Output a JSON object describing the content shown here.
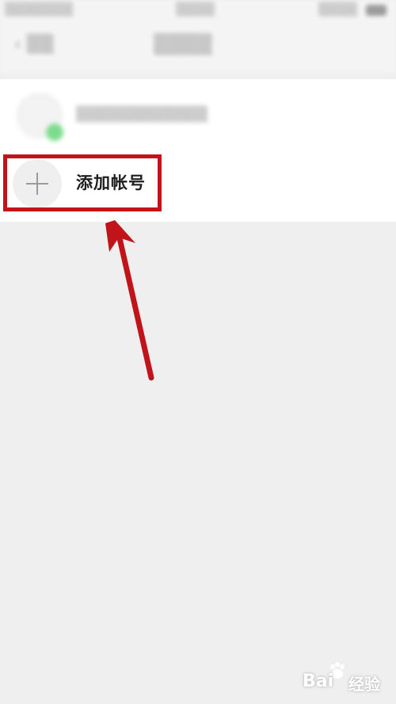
{
  "add_account": {
    "label": "添加帐号"
  },
  "icons": {
    "plus": "plus-icon",
    "arrow": "annotation-arrow-icon",
    "paw": "baidu-paw-icon"
  },
  "watermark": {
    "brand": "Bai",
    "brand_cn": "经验"
  },
  "colors": {
    "highlight": "#c0141a",
    "background": "#efefef",
    "online": "#66d77a"
  }
}
